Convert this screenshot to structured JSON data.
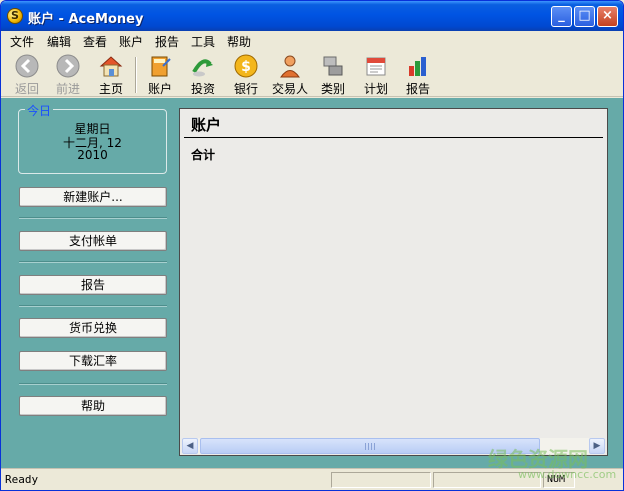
{
  "window": {
    "title": "账户 - AceMoney",
    "app_icon_glyph": "S"
  },
  "menu": [
    "文件",
    "编辑",
    "查看",
    "账户",
    "报告",
    "工具",
    "帮助"
  ],
  "toolbar": [
    {
      "label": "返回",
      "icon": "back-arrow-icon",
      "enabled": false
    },
    {
      "label": "前进",
      "icon": "forward-arrow-icon",
      "enabled": false
    },
    {
      "label": "主页",
      "icon": "home-icon",
      "enabled": true
    },
    {
      "label": "账户",
      "icon": "ledger-book-icon",
      "enabled": true
    },
    {
      "label": "投资",
      "icon": "investment-arrow-icon",
      "enabled": true
    },
    {
      "label": "银行",
      "icon": "bank-coin-icon",
      "enabled": true
    },
    {
      "label": "交易人",
      "icon": "payee-person-icon",
      "enabled": true
    },
    {
      "label": "类别",
      "icon": "category-blocks-icon",
      "enabled": true
    },
    {
      "label": "计划",
      "icon": "calendar-icon",
      "enabled": true
    },
    {
      "label": "报告",
      "icon": "report-chart-icon",
      "enabled": true
    }
  ],
  "today": {
    "legend": "今日",
    "weekday": "星期日",
    "date": "十二月, 12",
    "year": "2010"
  },
  "sidebar_buttons": [
    "新建账户...",
    "支付帐单",
    "报告",
    "货币兑换",
    "下载汇率",
    "帮助"
  ],
  "content": {
    "title": "账户",
    "total_label": "合计"
  },
  "status": {
    "text": "Ready",
    "num": "NUM"
  },
  "watermark": {
    "main": "绿色资源网",
    "sub": "www.downcc.com"
  },
  "colors": {
    "titlebar": "#0054e3",
    "panel_bg": "#66aaa8",
    "legend_text": "#1a4fff"
  }
}
